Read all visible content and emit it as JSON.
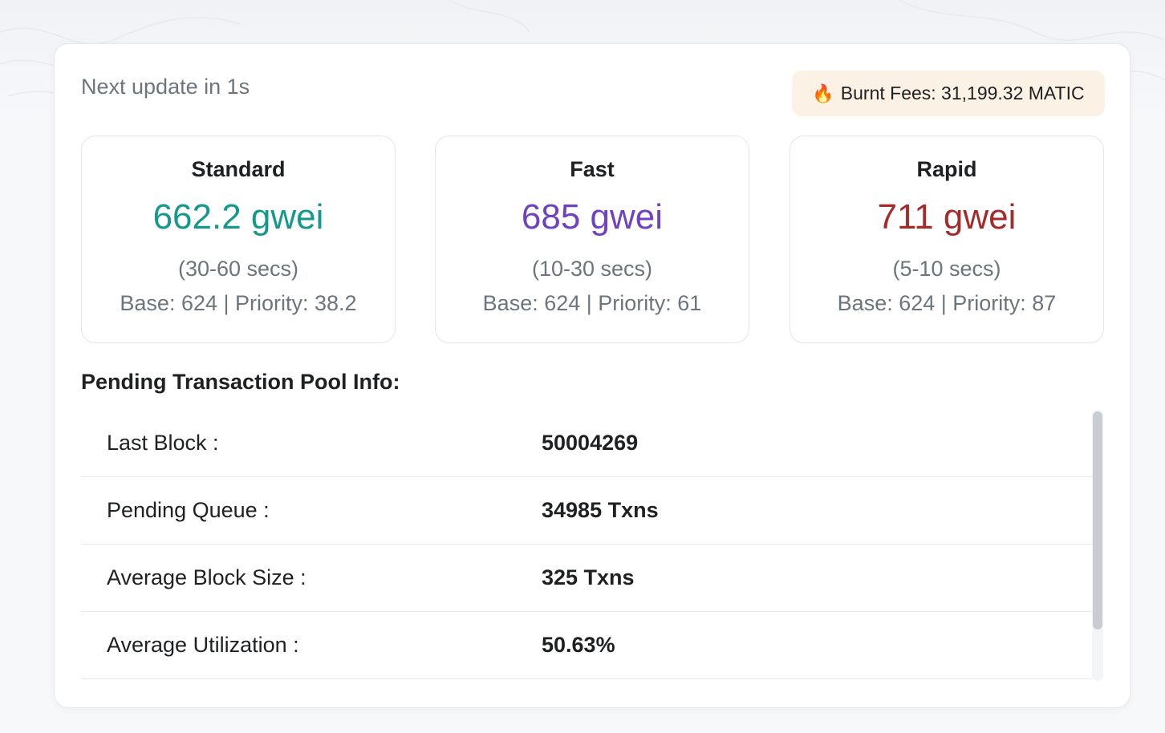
{
  "header": {
    "next_update": "Next update in 1s",
    "burnt_fees_icon": "fire-icon",
    "burnt_fees": "Burnt Fees: 31,199.32 MATIC"
  },
  "tiers": [
    {
      "name": "Standard",
      "price": "662.2 gwei",
      "time": "(30-60 secs)",
      "detail": "Base: 624 | Priority: 38.2",
      "color": "#14998a"
    },
    {
      "name": "Fast",
      "price": "685 gwei",
      "time": "(10-30 secs)",
      "detail": "Base: 624 | Priority: 61",
      "color": "#6f42c1"
    },
    {
      "name": "Rapid",
      "price": "711 gwei",
      "time": "(5-10 secs)",
      "detail": "Base: 624 | Priority: 87",
      "color": "#a52a2a"
    }
  ],
  "pool": {
    "title": "Pending Transaction Pool Info:",
    "rows": [
      {
        "label": "Last Block :",
        "value": "50004269"
      },
      {
        "label": "Pending Queue :",
        "value": "34985 Txns"
      },
      {
        "label": "Average Block Size :",
        "value": "325 Txns"
      },
      {
        "label": "Average Utilization :",
        "value": "50.63%"
      }
    ]
  }
}
